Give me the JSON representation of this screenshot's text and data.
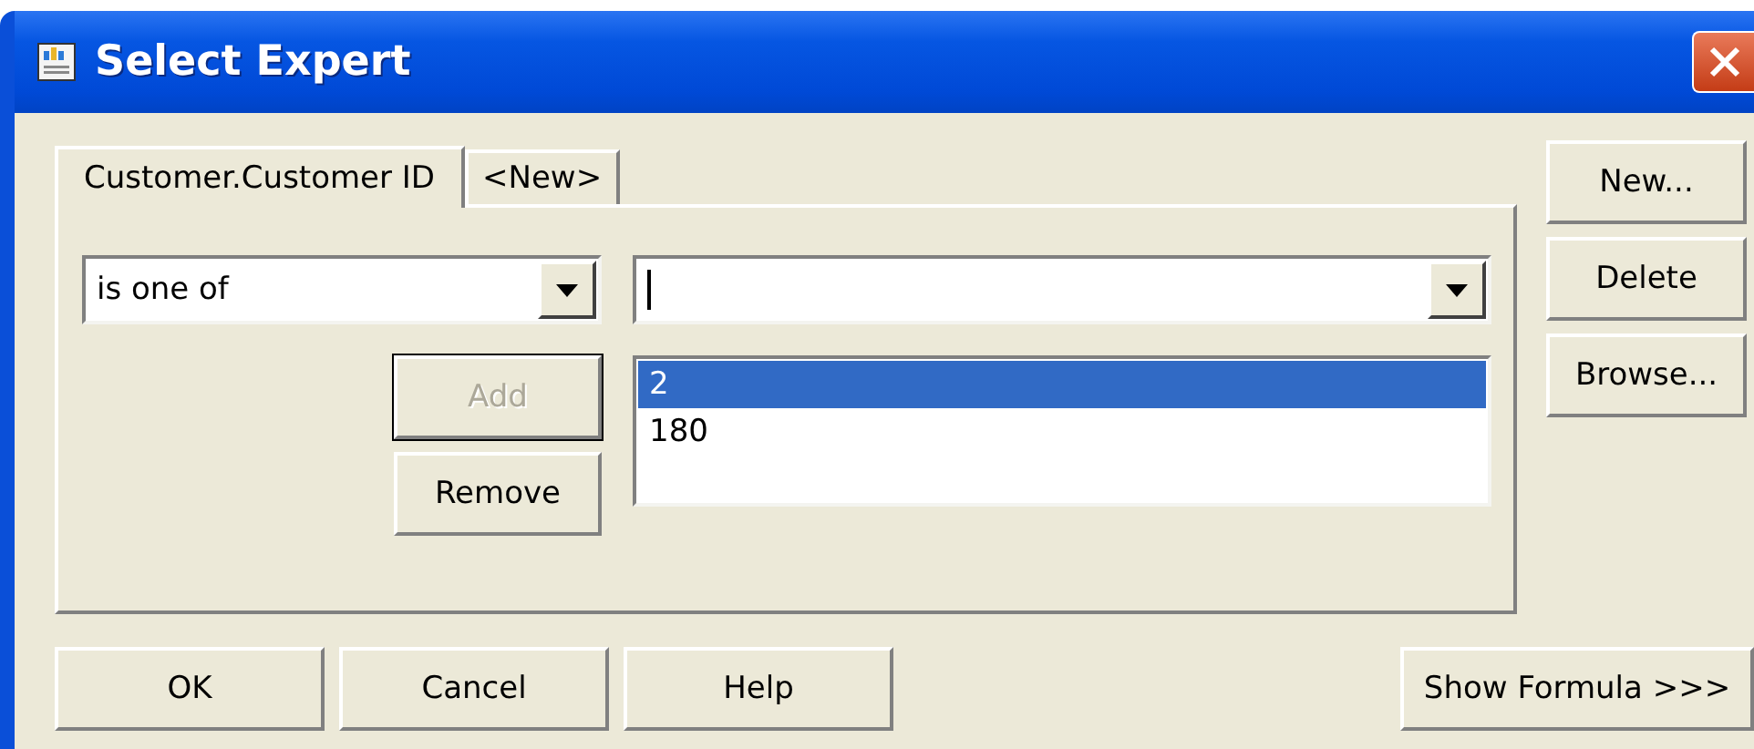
{
  "window": {
    "title": "Select Expert"
  },
  "tabs": [
    {
      "label": "Customer.Customer ID",
      "selected": true
    },
    {
      "label": "<New>",
      "selected": false
    }
  ],
  "operator_combo": {
    "value": "is one of"
  },
  "add_button": {
    "label": "Add",
    "disabled": true
  },
  "remove_button": {
    "label": "Remove",
    "disabled": false
  },
  "values_list": [
    {
      "label": "2",
      "selected": true
    },
    {
      "label": "180",
      "selected": false
    }
  ],
  "side_buttons": [
    "New...",
    "Delete",
    "Browse..."
  ],
  "bottom_buttons": [
    "OK",
    "Cancel",
    "Help"
  ],
  "formula_button": "Show Formula >>>"
}
